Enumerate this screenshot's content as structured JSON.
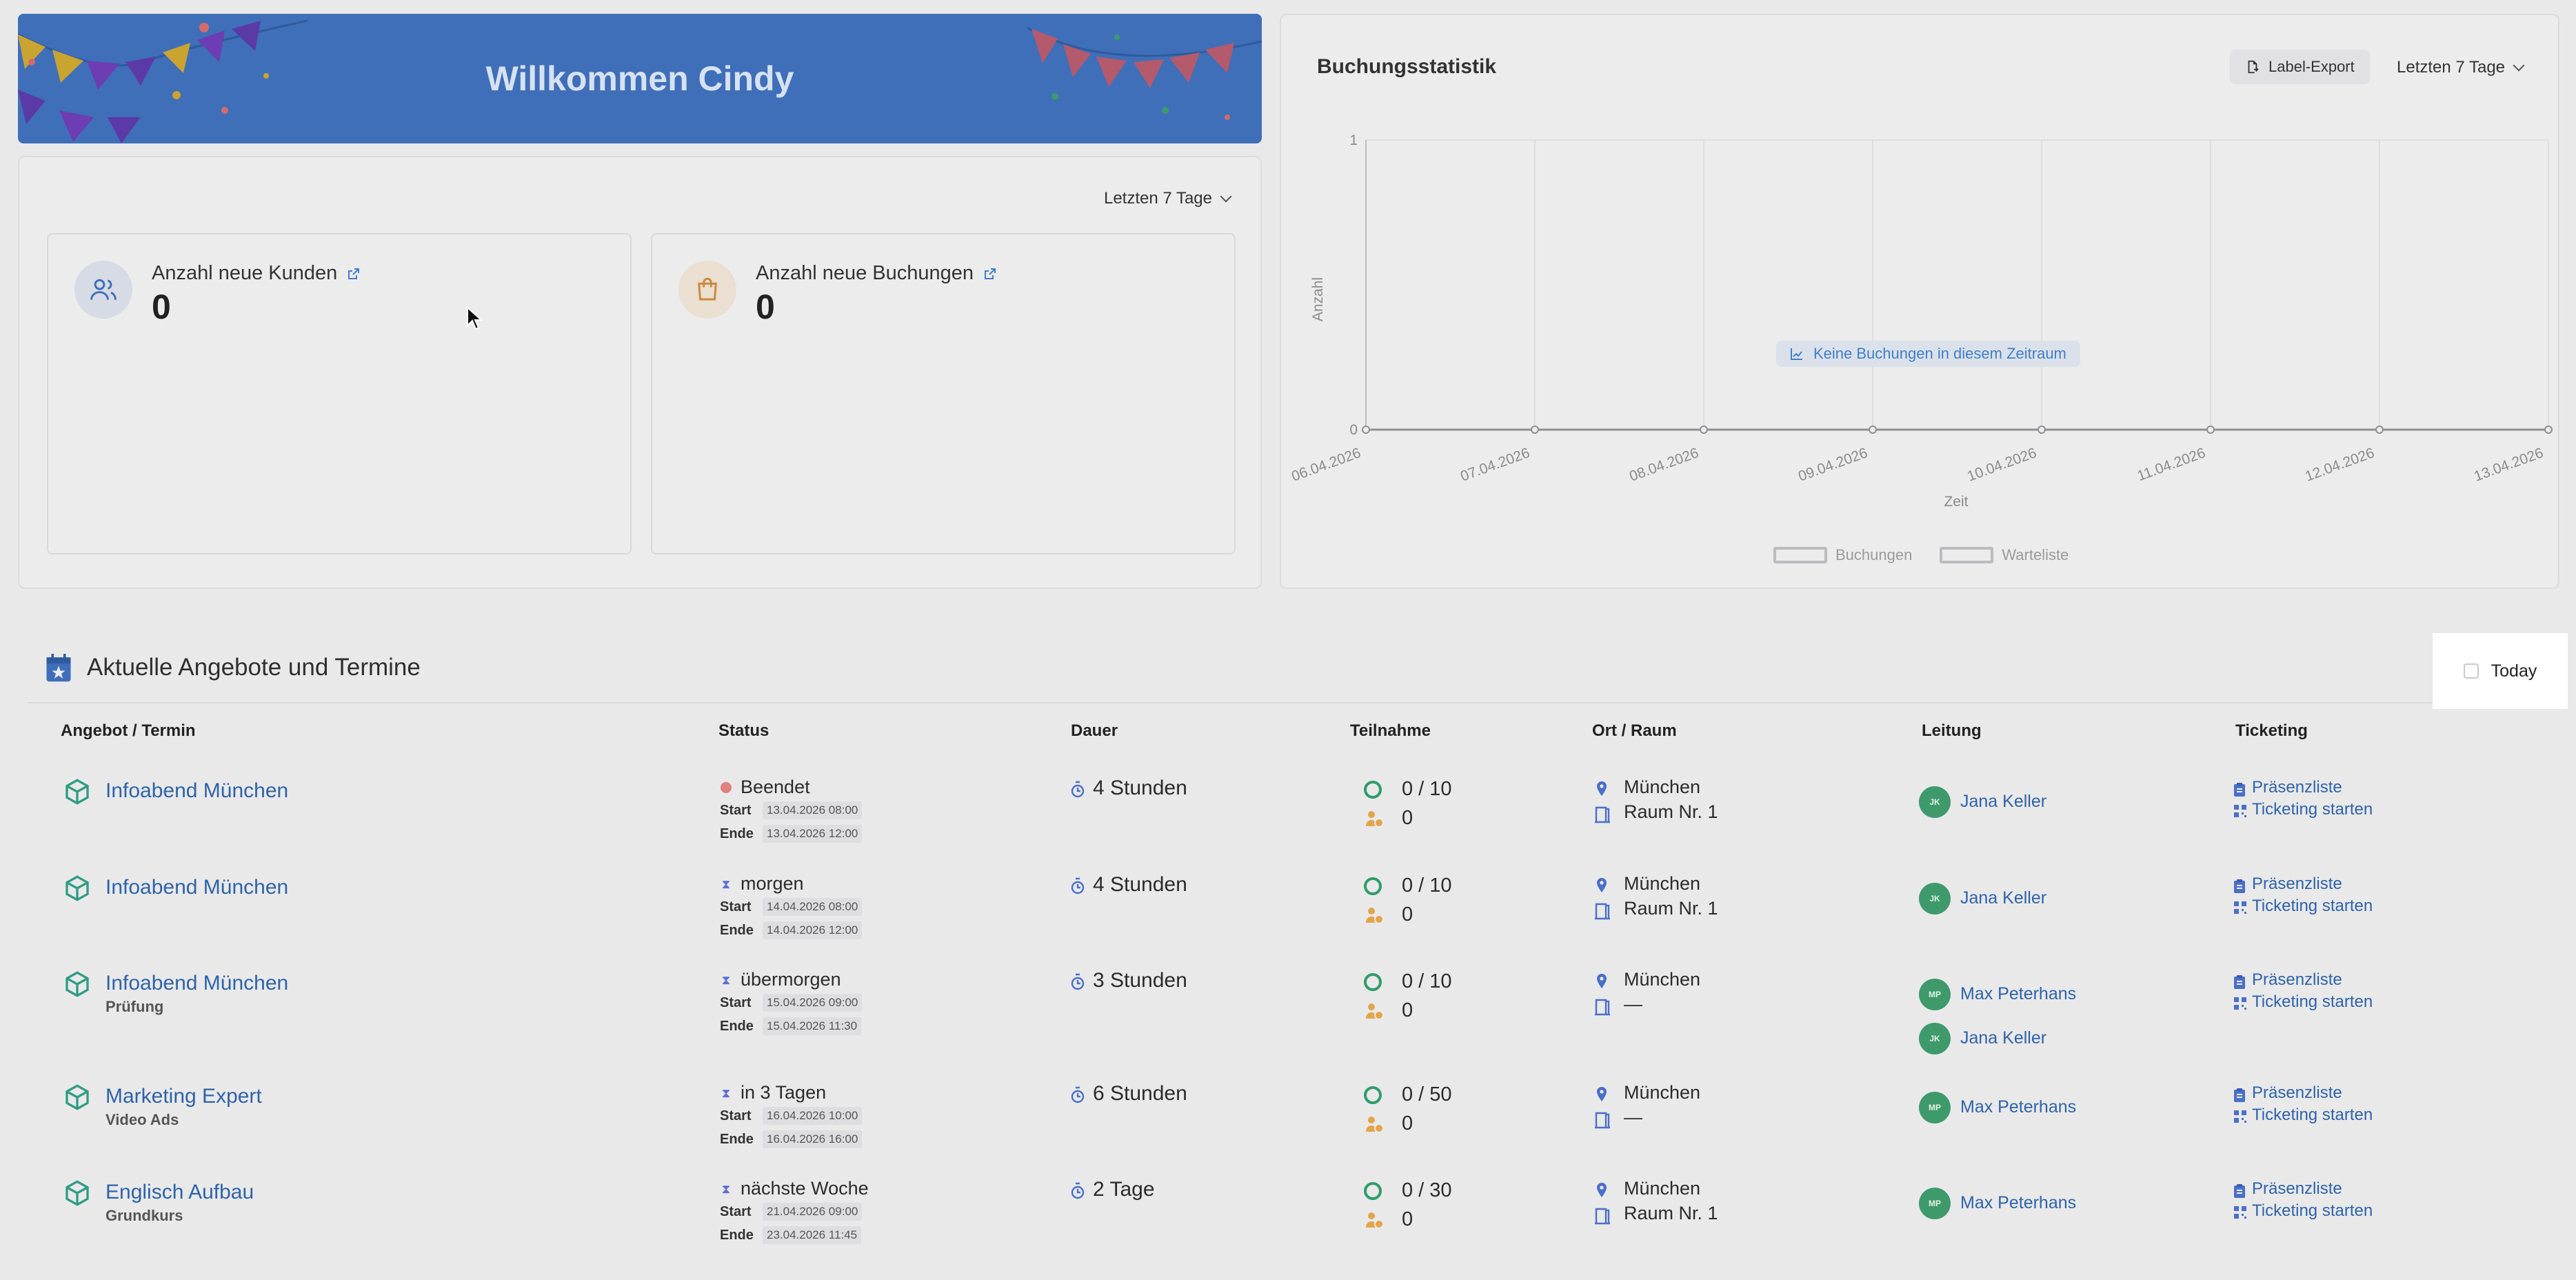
{
  "banner": {
    "title": "Willkommen Cindy"
  },
  "stats_panel": {
    "range_label": "Letzten 7 Tage",
    "cards": [
      {
        "label": "Anzahl neue Kunden",
        "value": "0",
        "icon": "users-icon"
      },
      {
        "label": "Anzahl neue Buchungen",
        "value": "0",
        "icon": "shopping-bag-icon"
      }
    ]
  },
  "chart_panel": {
    "title": "Buchungsstatistik",
    "export_label": "Label-Export",
    "range_label": "Letzten 7 Tage",
    "empty_message": "Keine Buchungen in diesem Zeitraum"
  },
  "chart_data": {
    "type": "line",
    "title": "Buchungsstatistik",
    "xlabel": "Zeit",
    "ylabel": "Anzahl",
    "x": [
      "06.04.2026",
      "07.04.2026",
      "08.04.2026",
      "09.04.2026",
      "10.04.2026",
      "11.04.2026",
      "12.04.2026",
      "13.04.2026"
    ],
    "ylim": [
      0,
      1
    ],
    "yticks": [
      "0",
      "1"
    ],
    "series": [
      {
        "name": "Buchungen",
        "values": [
          0,
          0,
          0,
          0,
          0,
          0,
          0,
          0
        ]
      },
      {
        "name": "Warteliste",
        "values": []
      }
    ],
    "legend": "bottom",
    "grid": true
  },
  "section": {
    "title": "Aktuelle Angebote und Termine",
    "today_label": "Today"
  },
  "table": {
    "headers": [
      "Angebot / Termin",
      "Status",
      "Dauer",
      "Teilnahme",
      "Ort / Raum",
      "Leitung",
      "Ticketing"
    ],
    "start_label": "Start",
    "end_label": "Ende",
    "ticket_links": [
      "Präsenzliste",
      "Ticketing starten"
    ],
    "rows": [
      {
        "title": "Infoabend München",
        "subtitle": "",
        "status": "Beendet",
        "status_color": "#d9534f",
        "start": "13.04.2026 08:00",
        "end": "13.04.2026 12:00",
        "dauer": "4 Stunden",
        "teilnahme": "0 / 10",
        "warteliste": "0",
        "ort": "München",
        "raum": "Raum Nr. 1",
        "leitung": [
          {
            "initials": "JK",
            "name": "Jana Keller"
          }
        ]
      },
      {
        "title": "Infoabend München",
        "subtitle": "",
        "status": "morgen",
        "status_color": "#5b6fd3",
        "start": "14.04.2026 08:00",
        "end": "14.04.2026 12:00",
        "dauer": "4 Stunden",
        "teilnahme": "0 / 10",
        "warteliste": "0",
        "ort": "München",
        "raum": "Raum Nr. 1",
        "leitung": [
          {
            "initials": "JK",
            "name": "Jana Keller"
          }
        ]
      },
      {
        "title": "Infoabend München",
        "subtitle": "Prüfung",
        "status": "übermorgen",
        "status_color": "#5b6fd3",
        "start": "15.04.2026 09:00",
        "end": "15.04.2026 11:30",
        "dauer": "3 Stunden",
        "teilnahme": "0 / 10",
        "warteliste": "0",
        "ort": "München",
        "raum": "—",
        "leitung": [
          {
            "initials": "MP",
            "name": "Max Peterhans"
          },
          {
            "initials": "JK",
            "name": "Jana Keller"
          }
        ]
      },
      {
        "title": "Marketing Expert",
        "subtitle": "Video Ads",
        "status": "in 3 Tagen",
        "status_color": "#5b6fd3",
        "start": "16.04.2026 10:00",
        "end": "16.04.2026 16:00",
        "dauer": "6 Stunden",
        "teilnahme": "0 / 50",
        "warteliste": "0",
        "ort": "München",
        "raum": "—",
        "leitung": [
          {
            "initials": "MP",
            "name": "Max Peterhans"
          }
        ]
      },
      {
        "title": "Englisch Aufbau",
        "subtitle": "Grundkurs",
        "status": "nächste Woche",
        "status_color": "#5b6fd3",
        "start": "21.04.2026 09:00",
        "end": "23.04.2026 11:45",
        "dauer": "2 Tage",
        "teilnahme": "0 / 30",
        "warteliste": "0",
        "ort": "München",
        "raum": "Raum Nr. 1",
        "leitung": [
          {
            "initials": "MP",
            "name": "Max Peterhans"
          }
        ]
      }
    ]
  }
}
